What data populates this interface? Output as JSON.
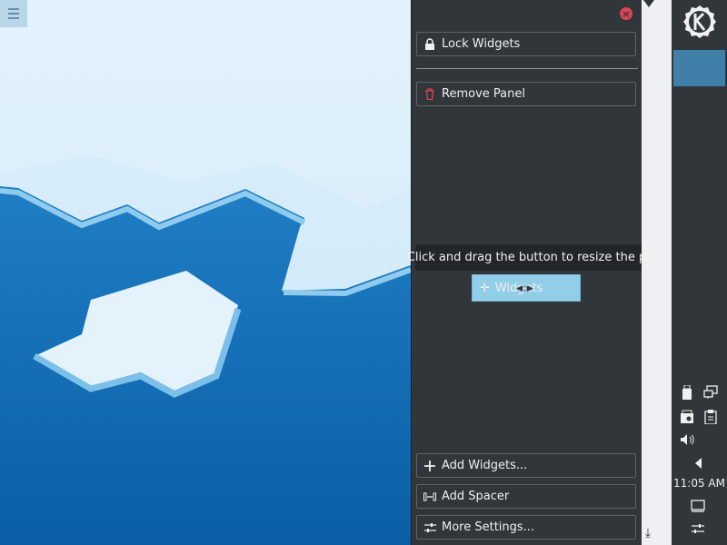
{
  "panel_config": {
    "lock_widgets_label": "Lock Widgets",
    "remove_panel_label": "Remove Panel",
    "add_widgets_label": "Add Widgets...",
    "add_spacer_label": "Add Spacer",
    "more_settings_label": "More Settings...",
    "tooltip_text": "Click and drag the button to resize the panel.",
    "widget_handle_label": "Widgets",
    "close_icon": "close-icon"
  },
  "panel": {
    "clock": "11:05 AM",
    "launcher_icon": "kde-logo-icon"
  },
  "colors": {
    "panel_bg": "#31363b",
    "accent": "#3daee9",
    "danger": "#da4453"
  }
}
